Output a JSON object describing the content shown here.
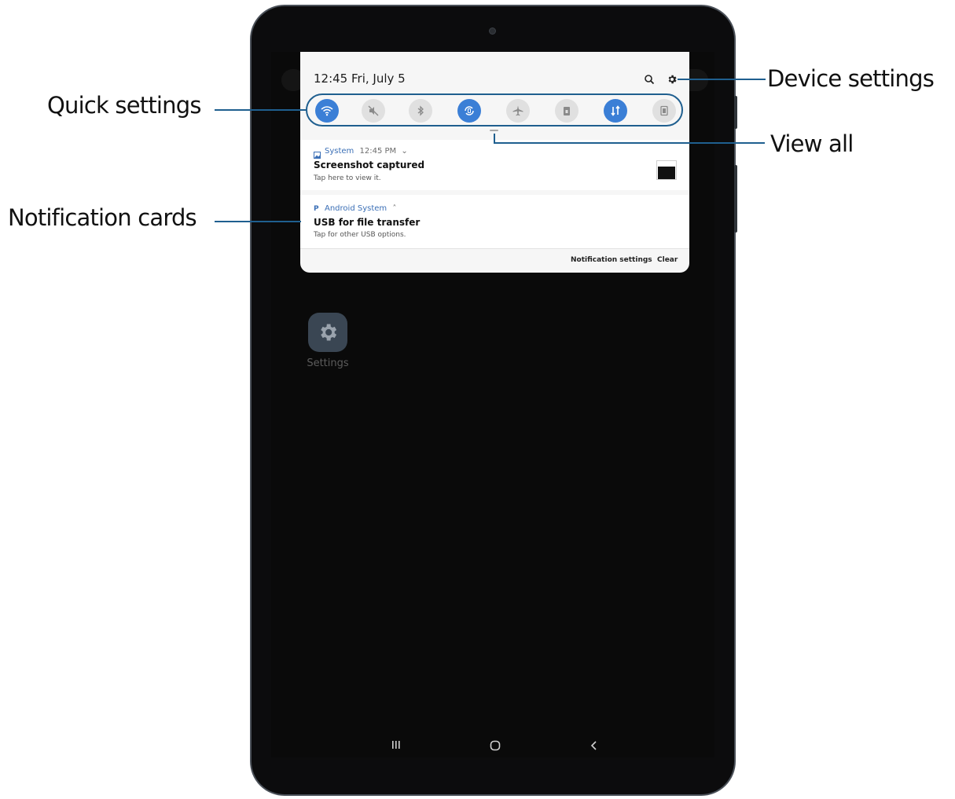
{
  "status_bar": {
    "time_date": "12:45  Fri, July 5"
  },
  "panel_icons": {
    "search": "search-icon",
    "settings": "gear-icon"
  },
  "quick_settings": [
    {
      "name": "wifi",
      "on": true
    },
    {
      "name": "sound-mute",
      "on": false
    },
    {
      "name": "bluetooth",
      "on": false
    },
    {
      "name": "auto-rotate",
      "on": true
    },
    {
      "name": "airplane-mode",
      "on": false
    },
    {
      "name": "flashlight",
      "on": false
    },
    {
      "name": "mobile-data",
      "on": true
    },
    {
      "name": "power-saving",
      "on": false
    }
  ],
  "notifications": [
    {
      "app": "System",
      "meta": "12:45 PM",
      "chevron": "⌄",
      "title": "Screenshot captured",
      "text": "Tap here to view it."
    },
    {
      "app": "Android System",
      "meta": "",
      "chevron": "˄",
      "title": "USB for file transfer",
      "text": "Tap for other USB options."
    }
  ],
  "panel_actions": {
    "notification_settings": "Notification settings",
    "clear": "Clear"
  },
  "home_screen": {
    "app_label": "Settings"
  },
  "callouts": {
    "quick_settings": "Quick settings",
    "notification_cards": "Notification cards",
    "device_settings": "Device settings",
    "view_all": "View all"
  },
  "colors": {
    "accent": "#3b7fd6",
    "callout_line": "#1f5f8f"
  }
}
